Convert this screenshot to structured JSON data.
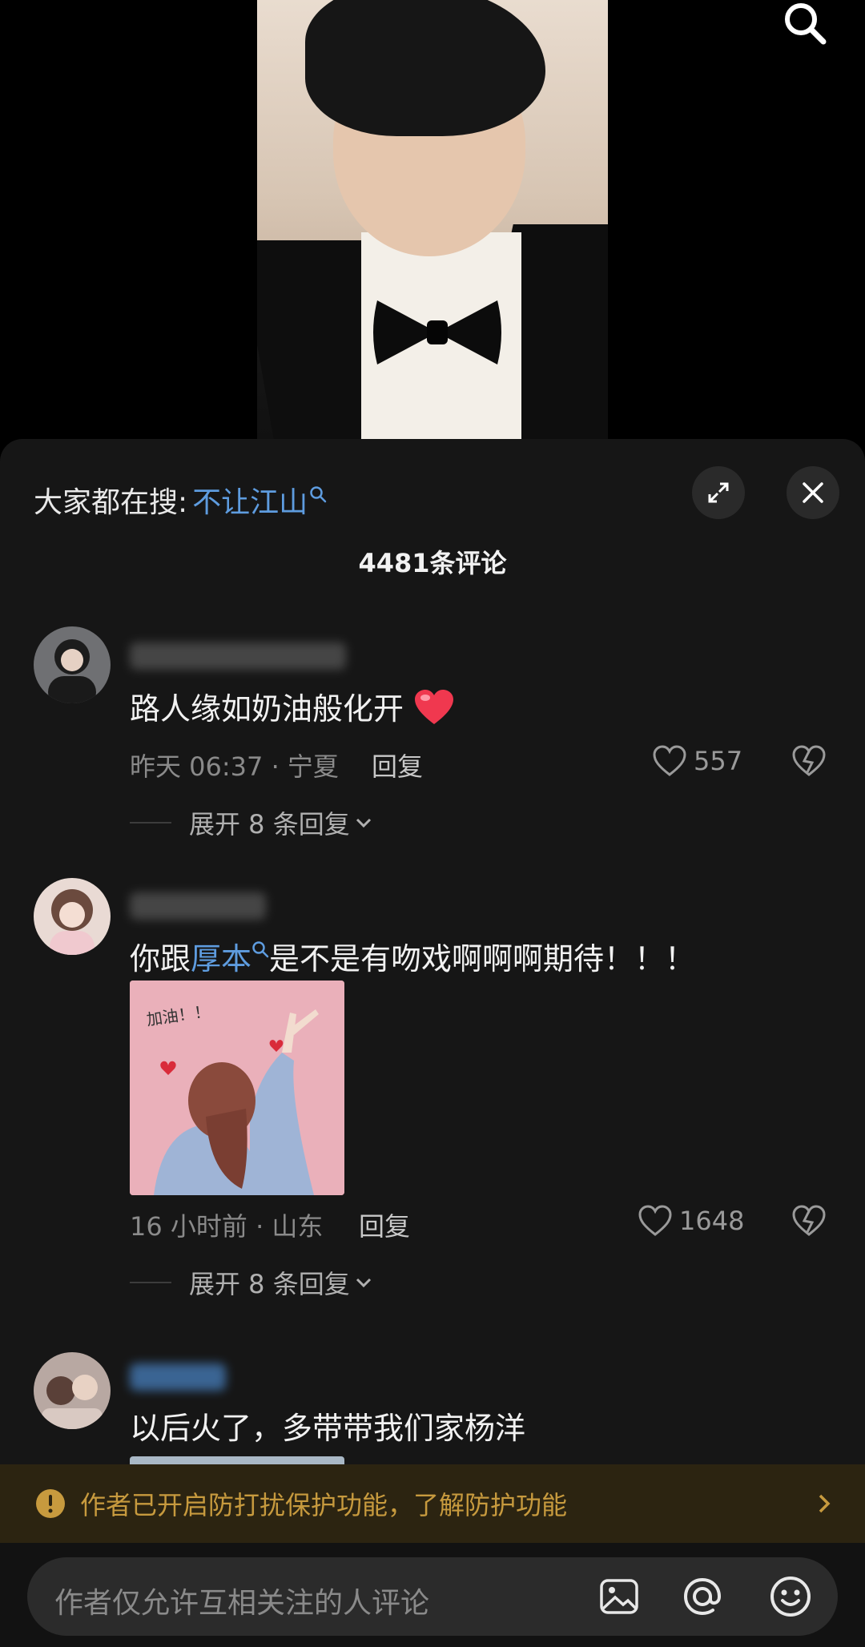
{
  "trending": {
    "prefix": "大家都在搜:",
    "term": "不让江山"
  },
  "comment_count": "4481条评论",
  "comments": [
    {
      "text": "路人缘如奶油般化开",
      "emoji": "red-heart",
      "time_location": "昨天 06:37 · 宁夏",
      "reply_label": "回复",
      "likes": "557",
      "expand_label": "展开 8 条回复"
    },
    {
      "text_before": "你跟",
      "link": "厚本",
      "text_after": "是不是有吻戏啊啊啊期待！！！",
      "image_text": "加油！！",
      "time_location": "16 小时前 · 山东",
      "reply_label": "回复",
      "likes": "1648",
      "expand_label": "展开 8 条回复"
    },
    {
      "text": "以后火了，多带带我们家杨洋"
    }
  ],
  "notice": {
    "text": "作者已开启防打扰保护功能，了解防护功能"
  },
  "input": {
    "placeholder": "作者仅允许互相关注的人评论"
  },
  "colors": {
    "link": "#5e9cdf",
    "notice_text": "#c79a3e",
    "notice_bg": "#2c2411",
    "sheet_bg": "#161616"
  }
}
